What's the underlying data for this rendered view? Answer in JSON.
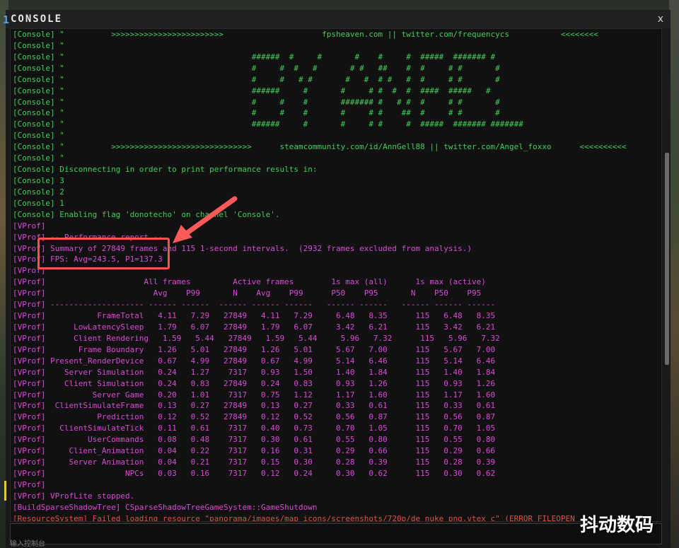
{
  "window": {
    "title_index": "1",
    "title": "CONSOLE",
    "close_label": "x"
  },
  "lines": [
    {
      "cls": "c",
      "text": "[Console] \"          >>>>>>>>>>>>>>>>>>>>>>>>                     fpsheaven.com || twitter.com/frequencycs           <<<<<<<<"
    },
    {
      "cls": "c",
      "text": "[Console] \""
    },
    {
      "cls": "c",
      "text": "[Console] \"                                        ######  #     #       #    #     #  #####  ####### #"
    },
    {
      "cls": "c",
      "text": "[Console] \"                                        #     #  #   #       # #   ##    #  #     # #       #"
    },
    {
      "cls": "c",
      "text": "[Console] \"                                        #     #   # #       #   #  # #   #  #     # #       #"
    },
    {
      "cls": "c",
      "text": "[Console] \"                                        ######     #       #     # #  #  #  ####  #####   #"
    },
    {
      "cls": "c",
      "text": "[Console] \"                                        #     #    #       ####### #   # #  #     # #       #"
    },
    {
      "cls": "c",
      "text": "[Console] \"                                        #     #    #       #     # #    ##  #     # #       #"
    },
    {
      "cls": "c",
      "text": "[Console] \"                                        ######     #       #     # #     #  #####  ####### #######"
    },
    {
      "cls": "c",
      "text": "[Console] \""
    },
    {
      "cls": "c",
      "text": "[Console] \"          >>>>>>>>>>>>>>>>>>>>>>>>>>>>>>      steamcommunity.com/id/AnnGell88 || twitter.com/Angel_foxxo      <<<<<<<<<<"
    },
    {
      "cls": "c",
      "text": "[Console] \""
    },
    {
      "cls": "c",
      "text": "[Console] Disconnecting in order to print performance results in:"
    },
    {
      "cls": "c",
      "text": "[Console] 3"
    },
    {
      "cls": "c",
      "text": "[Console] 2"
    },
    {
      "cls": "c",
      "text": "[Console] 1"
    },
    {
      "cls": "c",
      "text": "[Console] Enabling flag 'donotecho' on channel 'Console'."
    },
    {
      "cls": "v",
      "text": "[VProf]"
    },
    {
      "cls": "v",
      "text": "[VProf] -- Performance report --"
    },
    {
      "cls": "v",
      "text": "[VProf] Summary of 27849 frames and 115 1-second intervals.  (2932 frames excluded from analysis.)"
    },
    {
      "cls": "v",
      "text": "[VProf] FPS: Avg=243.5, P1=137.3"
    },
    {
      "cls": "v",
      "text": "[VProf]"
    },
    {
      "cls": "v",
      "text": "[VProf]                     All frames         Active frames        1s max (all)      1s max (active)"
    },
    {
      "cls": "v",
      "text": "[VProf]                       Avg    P99       N    Avg    P99      P50    P95       N    P50    P95"
    },
    {
      "cls": "v",
      "text": "[VProf] -------------------- ------ ------  ------ ------ ------   ------ ------   ------ ------ ------"
    },
    {
      "cls": "v",
      "text": "[VProf]           FrameTotal   4.11   7.29   27849   4.11   7.29     6.48   8.35      115   6.48   8.35"
    },
    {
      "cls": "v",
      "text": "[VProf]      LowLatencySleep   1.79   6.07   27849   1.79   6.07     3.42   6.21      115   3.42   6.21"
    },
    {
      "cls": "v",
      "text": "[VProf]      Client Rendering   1.59   5.44   27849   1.59   5.44     5.96   7.32      115   5.96   7.32"
    },
    {
      "cls": "v",
      "text": "[VProf]       Frame Boundary   1.26   5.01   27849   1.26   5.01     5.67   7.00      115   5.67   7.00"
    },
    {
      "cls": "v",
      "text": "[VProf] Present_RenderDevice   0.67   4.99   27849   0.67   4.99     5.14   6.46      115   5.14   6.46"
    },
    {
      "cls": "v",
      "text": "[VProf]    Server Simulation   0.24   1.27    7317   0.93   1.50     1.40   1.84      115   1.40   1.84"
    },
    {
      "cls": "v",
      "text": "[VProf]    Client Simulation   0.24   0.83   27849   0.24   0.83     0.93   1.26      115   0.93   1.26"
    },
    {
      "cls": "v",
      "text": "[VProf]          Server Game   0.20   1.01    7317   0.75   1.12     1.17   1.60      115   1.17   1.60"
    },
    {
      "cls": "v",
      "text": "[VProf]  ClientSimulateFrame   0.13   0.27   27849   0.13   0.27     0.33   0.61      115   0.33   0.61"
    },
    {
      "cls": "v",
      "text": "[VProf]           Prediction   0.12   0.52   27849   0.12   0.52     0.56   0.87      115   0.56   0.87"
    },
    {
      "cls": "v",
      "text": "[VProf]   ClientSimulateTick   0.11   0.61    7317   0.40   0.73     0.70   1.05      115   0.70   1.05"
    },
    {
      "cls": "v",
      "text": "[VProf]         UserCommands   0.08   0.48    7317   0.30   0.61     0.55   0.80      115   0.55   0.80"
    },
    {
      "cls": "v",
      "text": "[VProf]     Client_Animation   0.04   0.22    7317   0.16   0.31     0.29   0.66      115   0.29   0.66"
    },
    {
      "cls": "v",
      "text": "[VProf]     Server Animation   0.04   0.21    7317   0.15   0.30     0.28   0.39      115   0.28   0.39"
    },
    {
      "cls": "v",
      "text": "[VProf]                 NPCs   0.03   0.16    7317   0.12   0.24     0.30   0.62      115   0.30   0.62"
    },
    {
      "cls": "v",
      "text": "[VProf]"
    },
    {
      "cls": "v",
      "text": "[VProf] VProfLite stopped."
    },
    {
      "cls": "b",
      "text": "[BuildSparseShadowTree] CSparseShadowTreeGameSystem::GameShutdown"
    },
    {
      "cls": "e",
      "text": "[ResourceSystem] Failed loading resource \"panorama/images/map_icons/screenshots/720p/de_nuke_png.vtex_c\" (ERROR_FILEOPEN"
    }
  ],
  "input": {
    "value": "",
    "placeholder": ""
  },
  "watermark": "抖动数码",
  "bottom_text": "输入控制台"
}
